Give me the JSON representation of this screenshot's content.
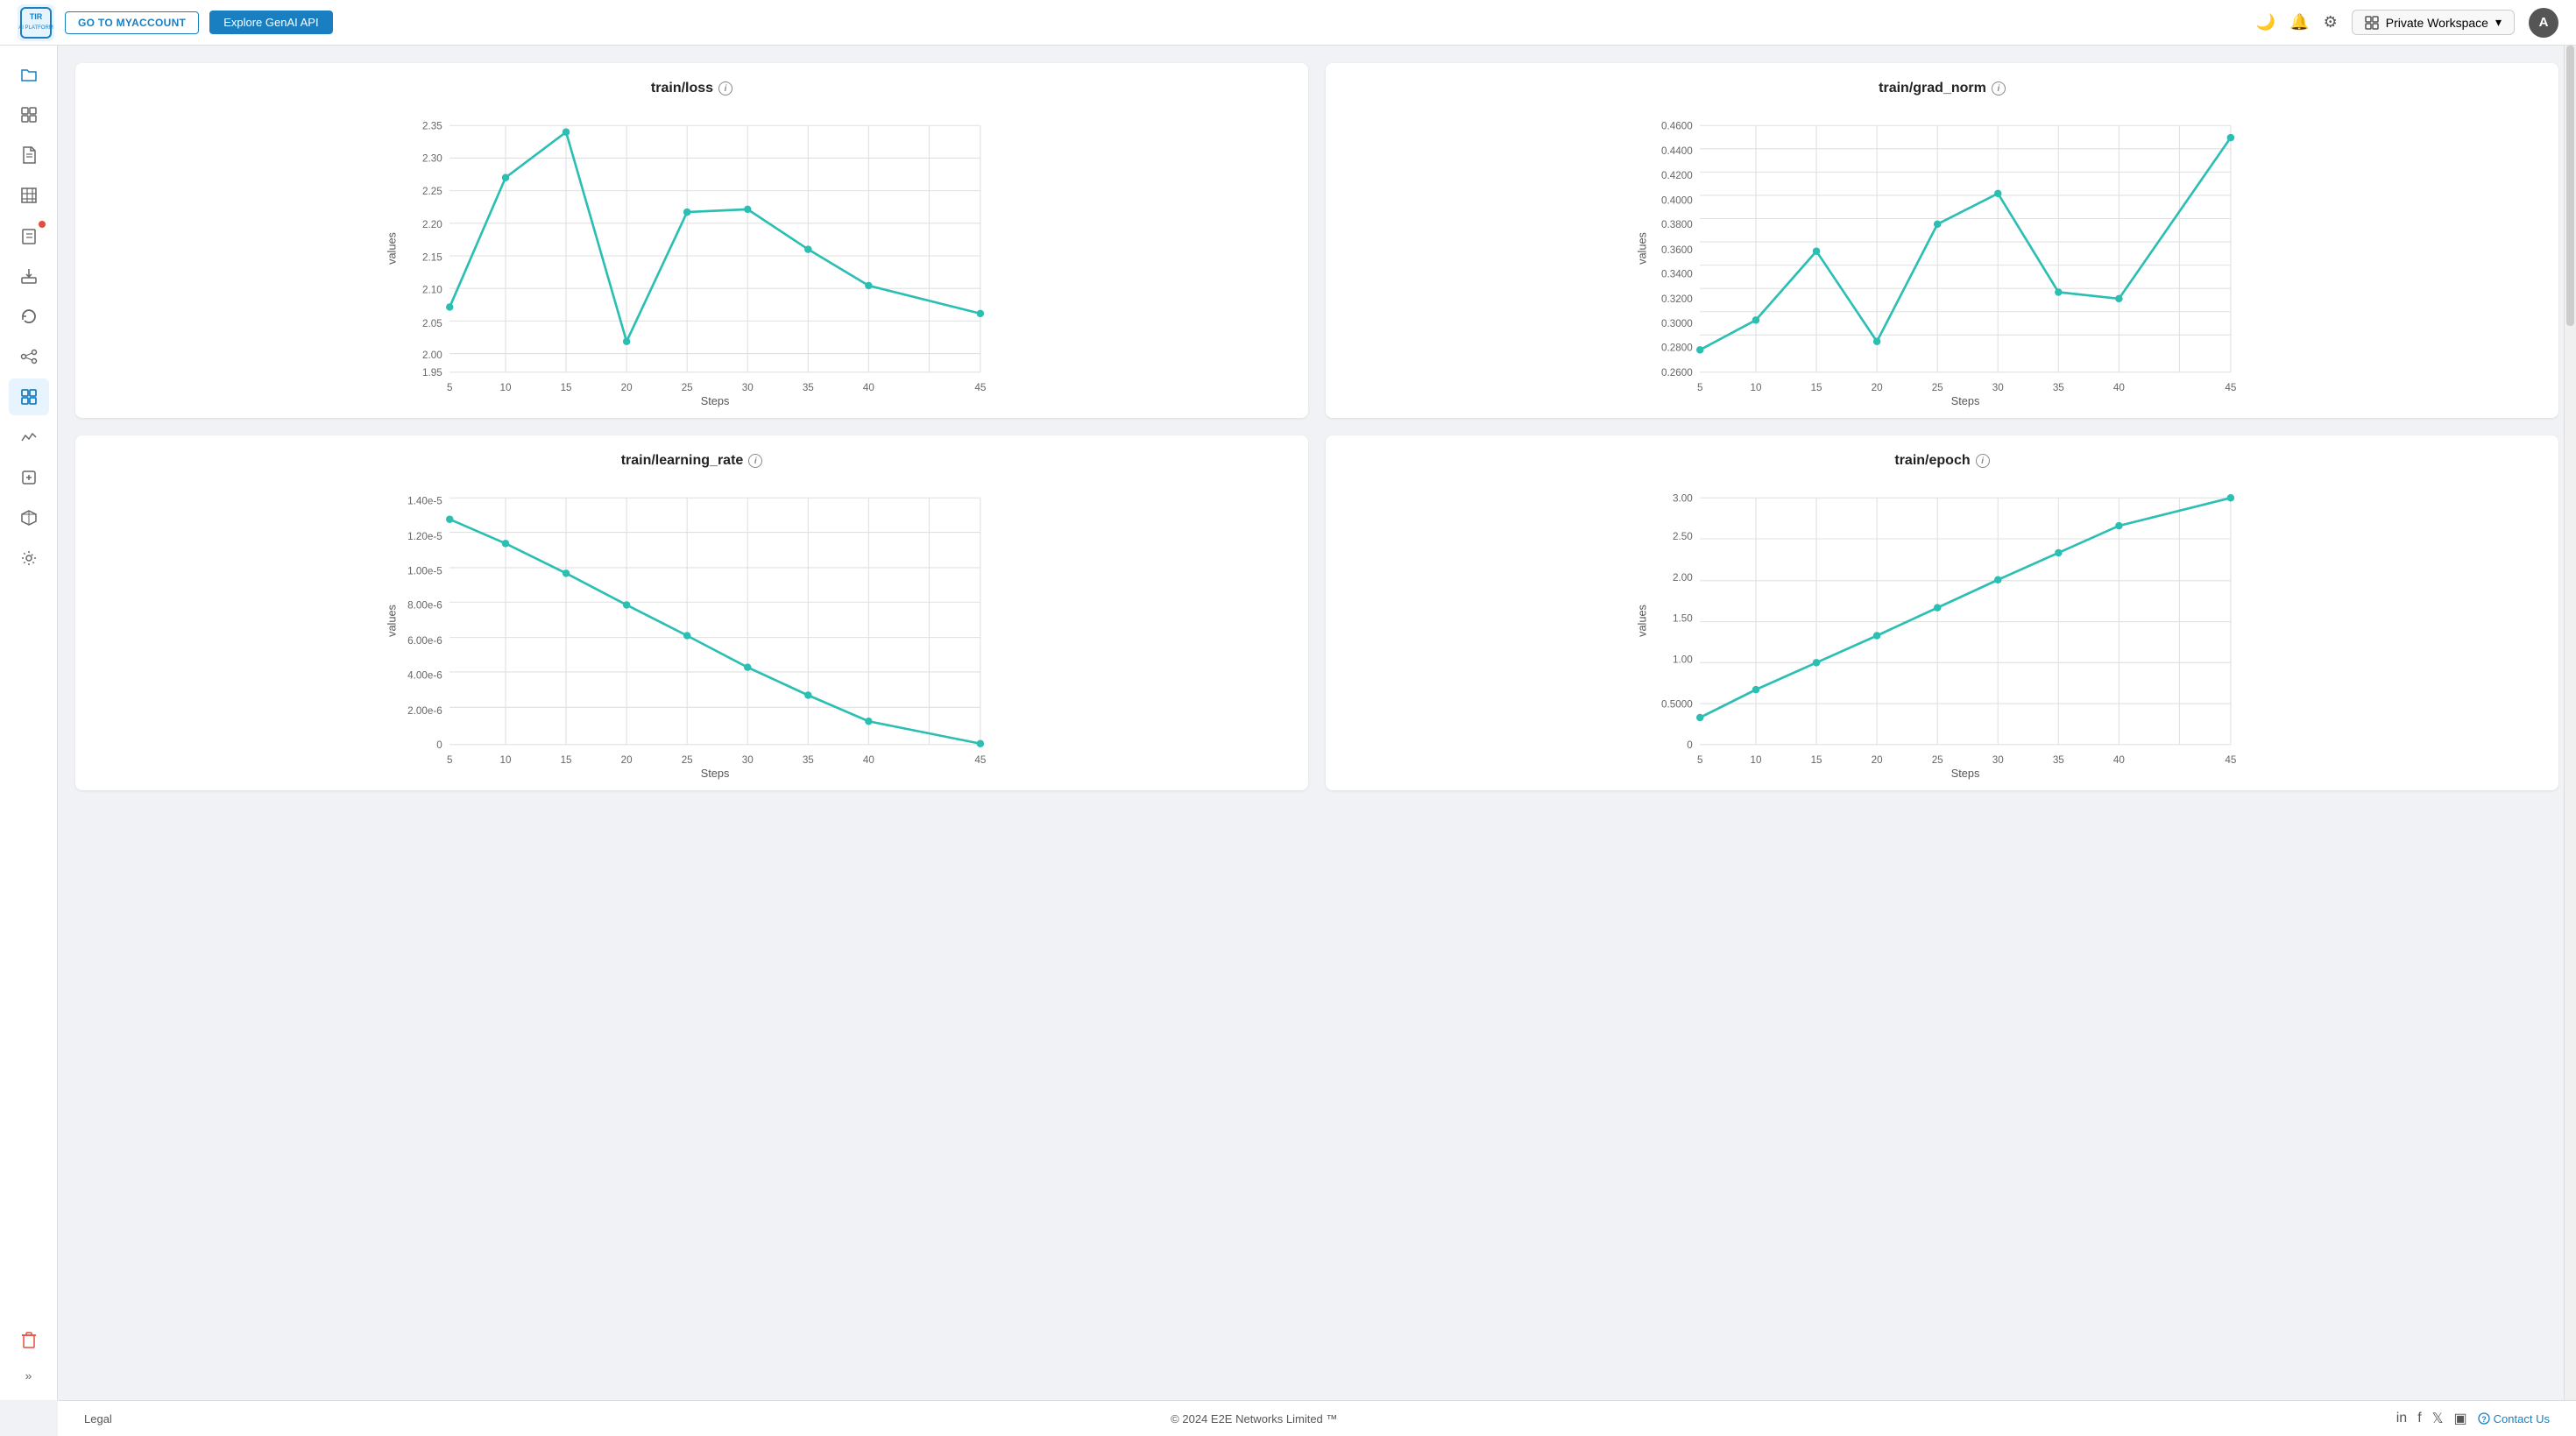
{
  "header": {
    "logo_text": "TIR\nAI PLATFORM",
    "btn_myaccount": "GO TO MYACCOUNT",
    "btn_genai": "Explore GenAI API",
    "workspace_label": "Private Workspace",
    "avatar_letter": "A"
  },
  "sidebar": {
    "items": [
      {
        "name": "folder-icon",
        "icon": "🗂",
        "active": false
      },
      {
        "name": "dashboard-icon",
        "icon": "⊞",
        "active": false
      },
      {
        "name": "document-icon",
        "icon": "📄",
        "active": false
      },
      {
        "name": "table-icon",
        "icon": "▦",
        "active": false
      },
      {
        "name": "badge-icon",
        "icon": "🔴",
        "active": false
      },
      {
        "name": "deploy-icon",
        "icon": "📦",
        "active": false
      },
      {
        "name": "refresh-icon",
        "icon": "↻",
        "active": false
      },
      {
        "name": "pipeline-icon",
        "icon": "⬡",
        "active": false
      },
      {
        "name": "training-icon",
        "icon": "▣",
        "active": true
      },
      {
        "name": "network-icon",
        "icon": "🔀",
        "active": false
      },
      {
        "name": "plugin-icon",
        "icon": "⊕",
        "active": false
      },
      {
        "name": "settings3d-icon",
        "icon": "⬡",
        "active": false
      },
      {
        "name": "settings-icon",
        "icon": "⚙",
        "active": false
      }
    ],
    "expand_icon": "»",
    "delete_icon": "🗑"
  },
  "charts": {
    "train_loss": {
      "title": "train/loss",
      "x_label": "Steps",
      "y_label": "values",
      "x_ticks": [
        5,
        10,
        15,
        20,
        25,
        30,
        35,
        40,
        45
      ],
      "y_ticks": [
        1.95,
        2.0,
        2.05,
        2.1,
        2.15,
        2.2,
        2.25,
        2.3,
        2.35
      ],
      "points": [
        {
          "x": 5,
          "y": 2.055
        },
        {
          "x": 10,
          "y": 2.265
        },
        {
          "x": 15,
          "y": 2.34
        },
        {
          "x": 20,
          "y": 2.0
        },
        {
          "x": 25,
          "y": 2.21
        },
        {
          "x": 30,
          "y": 2.215
        },
        {
          "x": 35,
          "y": 2.15
        },
        {
          "x": 40,
          "y": 2.09
        },
        {
          "x": 45,
          "y": 2.045
        }
      ]
    },
    "train_grad_norm": {
      "title": "train/grad_norm",
      "x_label": "Steps",
      "y_label": "values",
      "x_ticks": [
        5,
        10,
        15,
        20,
        25,
        30,
        35,
        40,
        45
      ],
      "y_ticks": [
        0.26,
        0.28,
        0.3,
        0.32,
        0.34,
        0.36,
        0.38,
        0.4,
        0.42,
        0.44,
        0.46
      ],
      "points": [
        {
          "x": 5,
          "y": 0.278
        },
        {
          "x": 10,
          "y": 0.302
        },
        {
          "x": 15,
          "y": 0.358
        },
        {
          "x": 20,
          "y": 0.285
        },
        {
          "x": 25,
          "y": 0.38
        },
        {
          "x": 30,
          "y": 0.405
        },
        {
          "x": 35,
          "y": 0.325
        },
        {
          "x": 40,
          "y": 0.32
        },
        {
          "x": 45,
          "y": 0.45
        }
      ]
    },
    "train_learning_rate": {
      "title": "train/learning_rate",
      "x_label": "Steps",
      "y_label": "values",
      "x_ticks": [
        5,
        10,
        15,
        20,
        25,
        30,
        35,
        40,
        45
      ],
      "y_ticks": [
        "0",
        "2.00e-6",
        "4.00e-6",
        "6.00e-6",
        "8.00e-6",
        "1.00e-5",
        "1.20e-5",
        "1.40e-5"
      ],
      "points": [
        {
          "x": 5,
          "y": 1.28e-05
        },
        {
          "x": 10,
          "y": 1.14e-05
        },
        {
          "x": 15,
          "y": 9.7e-06
        },
        {
          "x": 20,
          "y": 7.9e-06
        },
        {
          "x": 25,
          "y": 6.2e-06
        },
        {
          "x": 30,
          "y": 4.4e-06
        },
        {
          "x": 35,
          "y": 2.8e-06
        },
        {
          "x": 40,
          "y": 1.3e-06
        },
        {
          "x": 45,
          "y": 5e-08
        }
      ]
    },
    "train_epoch": {
      "title": "train/epoch",
      "x_label": "Steps",
      "y_label": "values",
      "x_ticks": [
        5,
        10,
        15,
        20,
        25,
        30,
        35,
        40,
        45
      ],
      "y_ticks": [
        0,
        0.5,
        1.0,
        1.5,
        2.0,
        2.5,
        3.0
      ],
      "points": [
        {
          "x": 5,
          "y": 0.33
        },
        {
          "x": 10,
          "y": 0.67
        },
        {
          "x": 15,
          "y": 1.0
        },
        {
          "x": 20,
          "y": 1.33
        },
        {
          "x": 25,
          "y": 1.67
        },
        {
          "x": 30,
          "y": 2.0
        },
        {
          "x": 35,
          "y": 2.33
        },
        {
          "x": 40,
          "y": 2.67
        },
        {
          "x": 45,
          "y": 3.0
        }
      ]
    }
  },
  "footer": {
    "copyright": "© 2024 E2E Networks Limited ™",
    "legal": "Legal",
    "contact_us": "Contact Us"
  }
}
